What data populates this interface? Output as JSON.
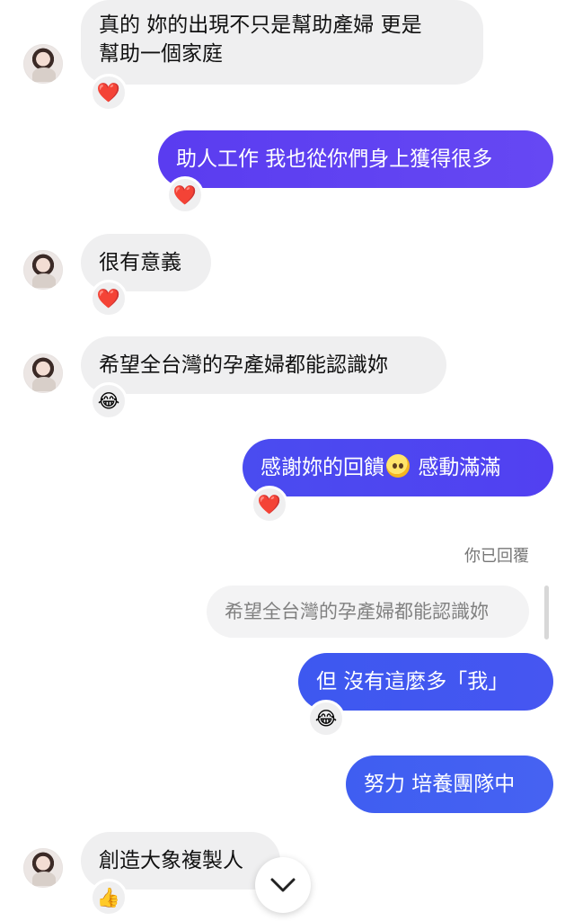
{
  "colors": {
    "incoming_bubble": "#efeff0",
    "outgoing_purple": "#5b3ef2",
    "outgoing_blue": "#3f5ef1",
    "heart": "#e0243c"
  },
  "messages": [
    {
      "id": "m1",
      "direction": "incoming",
      "lines": [
        "真的 妳的出現不只是幫助產婦 更是",
        "幫助一個家庭"
      ],
      "reaction": "❤️"
    },
    {
      "id": "m2",
      "direction": "outgoing",
      "text": "助人工作 我也從你們身上獲得很多",
      "reaction": "❤️"
    },
    {
      "id": "m3",
      "direction": "incoming",
      "text": "很有意義",
      "reaction": "❤️"
    },
    {
      "id": "m4",
      "direction": "incoming",
      "text": "希望全台灣的孕產婦都能認識妳",
      "reaction": "😂"
    },
    {
      "id": "m5",
      "direction": "outgoing",
      "text_before": "感謝妳的回饋",
      "inline_emoji": "pleading-face-emoji",
      "text_after": "感動滿滿",
      "reaction": "❤️"
    },
    {
      "id": "m6",
      "direction": "outgoing",
      "reply_label": "你已回覆",
      "quoted": "希望全台灣的孕產婦都能認識妳",
      "text": "但 沒有這麼多「我」",
      "reaction": "😂"
    },
    {
      "id": "m7",
      "direction": "outgoing",
      "text": "努力 培養團隊中"
    },
    {
      "id": "m8",
      "direction": "incoming",
      "text": "創造大象複製人",
      "reaction": "👍"
    }
  ],
  "scroll_button": {
    "icon": "chevron-down-icon"
  }
}
